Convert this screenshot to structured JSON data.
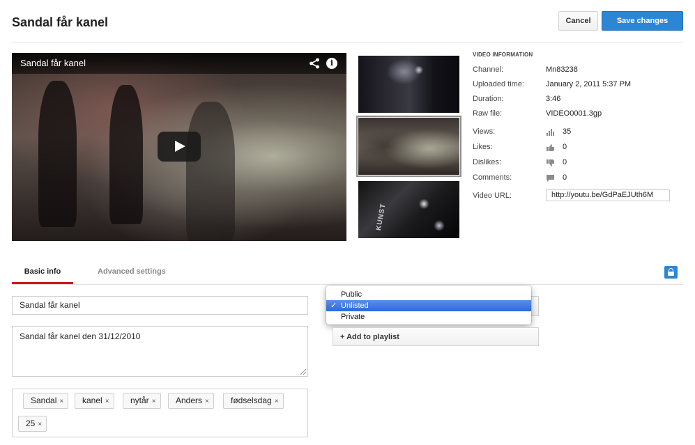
{
  "header": {
    "title": "Sandal får kanel",
    "cancel_label": "Cancel",
    "save_label": "Save changes"
  },
  "player": {
    "title": "Sandal får kanel",
    "icons": [
      "share-icon",
      "info-icon",
      "play-icon"
    ]
  },
  "thumbnails": {
    "count": 3,
    "selected_index": 1,
    "thumb3_text": "KUNST"
  },
  "video_info": {
    "heading": "VIDEO INFORMATION",
    "channel_label": "Channel:",
    "channel_value": "Mn83238",
    "uploaded_label": "Uploaded time:",
    "uploaded_value": "January 2, 2011 5:37 PM",
    "duration_label": "Duration:",
    "duration_value": "3:46",
    "raw_label": "Raw file:",
    "raw_value": "VIDEO0001.3gp",
    "views_label": "Views:",
    "views_value": "35",
    "likes_label": "Likes:",
    "likes_value": "0",
    "dislikes_label": "Dislikes:",
    "dislikes_value": "0",
    "comments_label": "Comments:",
    "comments_value": "0",
    "url_label": "Video URL:",
    "url_value": "http://youtu.be/GdPaEJUth6M"
  },
  "tabs": {
    "basic_label": "Basic info",
    "advanced_label": "Advanced settings",
    "active": "Basic info"
  },
  "form": {
    "title_value": "Sandal får kanel",
    "description_value": "Sandal får kanel den 31/12/2010",
    "tags": [
      "Sandal",
      "kanel",
      "nytår",
      "Anders",
      "fødselsdag",
      "25"
    ],
    "tag_remove_glyph": "×"
  },
  "privacy": {
    "options": [
      "Public",
      "Unlisted",
      "Private"
    ],
    "selected": "Unlisted",
    "check_glyph": "✓",
    "playlist_label": "+ Add to playlist"
  },
  "colors": {
    "accent_blue": "#2c86d6",
    "tab_red": "#cc181e",
    "menu_highlight": "#3b75e0"
  }
}
